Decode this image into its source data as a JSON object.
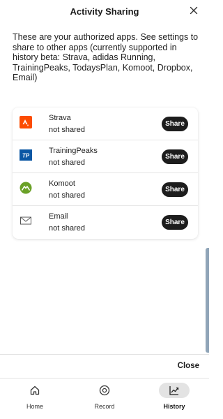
{
  "header": {
    "title": "Activity Sharing",
    "close_icon": "close-icon"
  },
  "intro_text": "These are your authorized apps. See settings to share to other apps (currently supported in history beta: Strava, adidas Running, TrainingPeaks, TodaysPlan, Komoot, Dropbox, Email)",
  "apps": [
    {
      "name": "Strava",
      "status": "not shared",
      "share_label": "Share",
      "icon": "strava-logo",
      "icon_color": "#fc4c02"
    },
    {
      "name": "TrainingPeaks",
      "status": "not shared",
      "share_label": "Share",
      "icon": "trainingpeaks-logo",
      "icon_text": "TP",
      "icon_color": "#0b57a4"
    },
    {
      "name": "Komoot",
      "status": "not shared",
      "share_label": "Share",
      "icon": "komoot-logo",
      "icon_color": "#6aa127"
    },
    {
      "name": "Email",
      "status": "not shared",
      "share_label": "Share",
      "icon": "envelope-icon",
      "icon_color": "#555555"
    }
  ],
  "footer": {
    "close_label": "Close"
  },
  "nav": {
    "items": [
      {
        "label": "Home",
        "icon": "home-icon",
        "active": false
      },
      {
        "label": "Record",
        "icon": "record-icon",
        "active": false
      },
      {
        "label": "History",
        "icon": "history-chart-icon",
        "active": true
      }
    ]
  },
  "colors": {
    "share_button": "#1d1d1d",
    "scrollbar": "#90a5b8",
    "active_nav_pill": "#e3e3e3"
  }
}
